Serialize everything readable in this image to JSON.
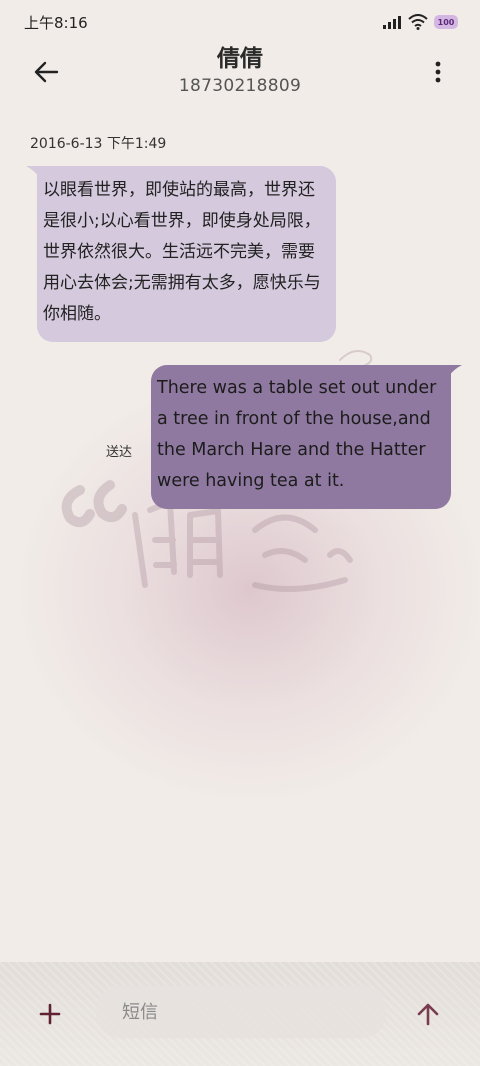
{
  "status_bar": {
    "time": "上午8:16",
    "battery": "100"
  },
  "header": {
    "contact_name": "倩倩",
    "phone_number": "18730218809"
  },
  "conversation": {
    "timestamp": "2016-6-13 下午1:49",
    "messages": [
      {
        "direction": "incoming",
        "text": "以眼看世界，即使站的最高，世界还是很小;以心看世界，即使身处局限，世界依然很大。生活远不完美，需要用心去体会;无需拥有太多，愿快乐与你相随。"
      },
      {
        "direction": "outgoing",
        "text": "There was a table set out under a tree in front of the house,and the March Hare and the Hatter were having tea at it.",
        "status": "送达"
      }
    ]
  },
  "compose": {
    "placeholder": "短信"
  },
  "colors": {
    "incoming_bubble": "#d5c9dd",
    "outgoing_bubble": "#8f79a0",
    "accent": "#7a3b50",
    "background": "#f1ece7"
  },
  "icons": {
    "back": "arrow-left-icon",
    "more": "more-vertical-icon",
    "add": "plus-icon",
    "send": "arrow-up-icon",
    "signal": "signal-icon",
    "wifi": "wifi-icon",
    "battery": "battery-icon"
  }
}
